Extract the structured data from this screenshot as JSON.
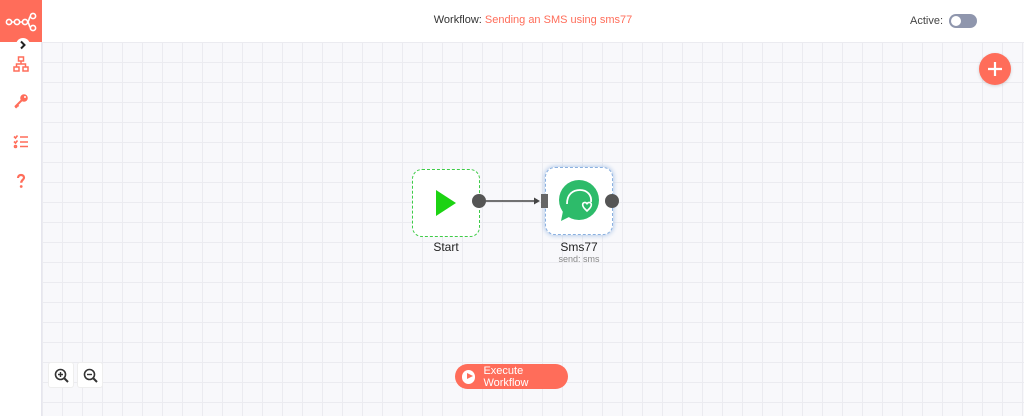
{
  "header": {
    "workflow_label": "Workflow:",
    "workflow_name": "Sending an SMS using sms77",
    "active_label": "Active:"
  },
  "workflow": {
    "active": false
  },
  "sidebar": {
    "icons": [
      "n8n-logo",
      "chevron-right-icon",
      "workflow-tree-icon",
      "key-icon",
      "checklist-icon",
      "help-icon"
    ]
  },
  "nodes": {
    "start": {
      "label": "Start",
      "icon": "play-icon"
    },
    "sms77": {
      "label": "Sms77",
      "subtitle": "send: sms",
      "icon": "sms77-icon"
    }
  },
  "footer": {
    "execute_label": "Execute Workflow"
  },
  "colors": {
    "brand": "#ff6d5a",
    "start_green": "#1cd312",
    "sms_green": "#2dbb6a"
  }
}
